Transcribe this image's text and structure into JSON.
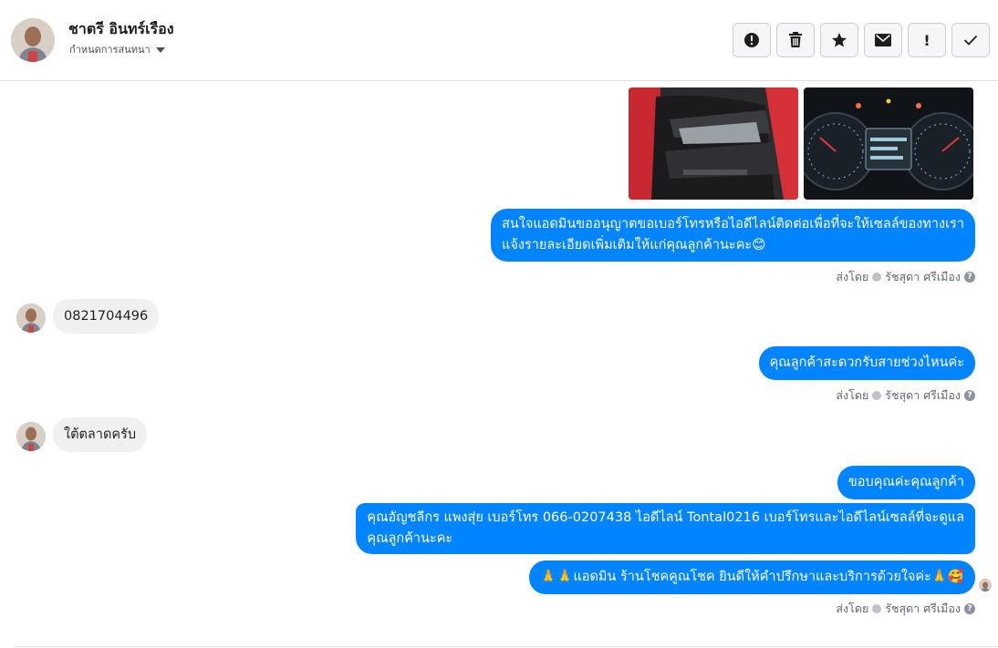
{
  "header": {
    "contact_name": "ชาตรี อินทร์เรือง",
    "assign_label": "กำหนดการสนทนา"
  },
  "toolbar": {
    "buttons": [
      {
        "icon": "alert-circle-icon"
      },
      {
        "icon": "trash-icon"
      },
      {
        "icon": "star-icon"
      },
      {
        "icon": "envelope-icon"
      },
      {
        "icon": "exclamation-icon",
        "glyph": "!"
      },
      {
        "icon": "checkmark-icon"
      }
    ]
  },
  "messages": {
    "m1_line1": "สนใจแอดมินขออนุญาตขอเบอร์โทรหรือไอดีไลน์ติดต่อเพื่อที่จะให้เซลล์ของทางเรา",
    "m1_line2": "แจ้งรายละเอียดเพิ่มเติมให้แก่คุณลูกค้านะคะ😊",
    "in1": "0821704496",
    "m2": "คุณลูกค้าสะดวกรับสายช่วงไหนค่ะ",
    "in2": "ใต้ตลาดครับ",
    "m3": "ขอบคุณค่ะคุณลูกค้า",
    "m4_line1": "คุณอัญชลีกร แพงสุ่ย      เบอร์โทร 066-0207438 ไอดีไลน์ Tontal0216   เบอร์โทรและไอดีไลน์เซลล์ที่จะดูแล",
    "m4_line2": "คุณลูกค้านะคะ",
    "m5": "🙏🙏แอดมิน ร้านโชคคูณโชค ยินดีให้คำปรึกษาและบริการด้วยใจค่ะ🙏🥰"
  },
  "sent_by": {
    "prefix": "ส่งโดย",
    "agent": "รัชสุดา ศรีเมือง",
    "help_glyph": "?"
  },
  "colors": {
    "outgoing_bubble": "#0084ff",
    "incoming_bubble": "#f1f0f0"
  }
}
